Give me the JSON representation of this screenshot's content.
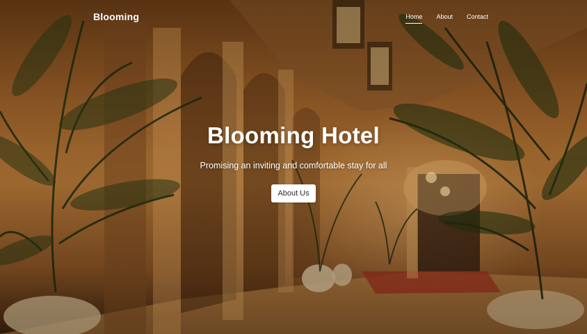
{
  "nav": {
    "brand": "Blooming",
    "links": [
      {
        "label": "Home",
        "active": true
      },
      {
        "label": "About",
        "active": false
      },
      {
        "label": "Contact",
        "active": false
      }
    ]
  },
  "hero": {
    "title": "Blooming Hotel",
    "subtitle": "Promising an inviting and comfortable stay for all",
    "button_label": "About Us"
  },
  "colors": {
    "text": "#ffffff",
    "button_bg": "#ffffff",
    "button_text": "#2a2a2a",
    "scene_warm": "#b27636"
  }
}
